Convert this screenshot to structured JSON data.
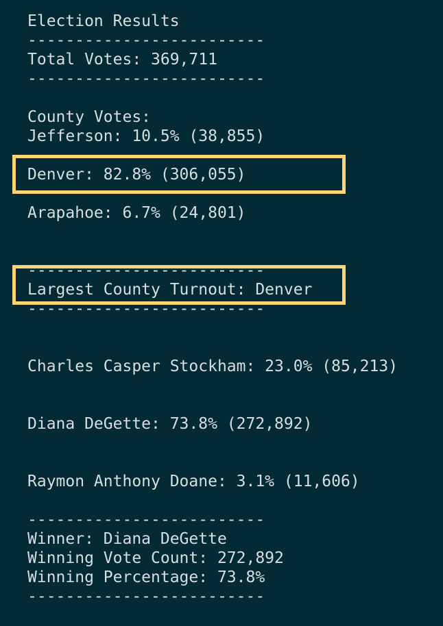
{
  "terminal": {
    "title_line": "Election Results",
    "separator": "-------------------------",
    "total_votes_line": "Total Votes: 369,711",
    "county_votes_header": "County Votes:",
    "county_lines": [
      "Jefferson: 10.5% (38,855)",
      "Denver: 82.8% (306,055)",
      "Arapahoe: 6.7% (24,801)"
    ],
    "largest_county_line": "Largest County Turnout: Denver",
    "candidate_lines": [
      "Charles Casper Stockham: 23.0% (85,213)",
      "Diana DeGette: 73.8% (272,892)",
      "Raymon Anthony Doane: 3.1% (11,606)"
    ],
    "winner_line": "Winner: Diana DeGette",
    "winning_count_line": "Winning Vote Count: 272,892",
    "winning_percentage_line": "Winning Percentage: 73.8%"
  },
  "colors": {
    "background": "#042a35",
    "text": "#d8dde0",
    "highlight": "#fcd57b"
  }
}
